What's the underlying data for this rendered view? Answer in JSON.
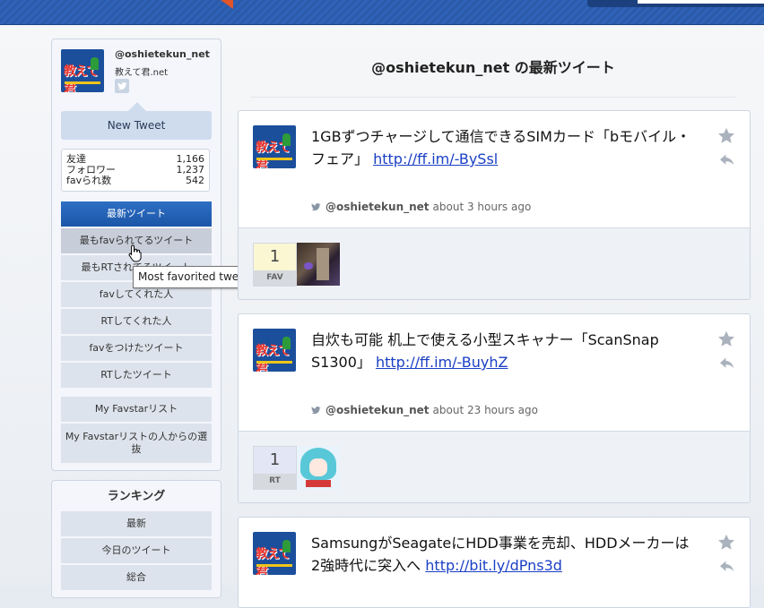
{
  "profile": {
    "username": "@oshietekun_net",
    "subtitle": "教えて君.net",
    "avatar_text": "教えて君",
    "new_tweet_label": "New Tweet",
    "stats": [
      {
        "label": "友達",
        "value": "1,166"
      },
      {
        "label": "フォロワー",
        "value": "1,237"
      },
      {
        "label": "favられ数",
        "value": "542"
      }
    ]
  },
  "menu": {
    "items": [
      {
        "label": "最新ツイート",
        "active": true
      },
      {
        "label": "最もfavられてるツイート"
      },
      {
        "label": "最もRTされてるツイート"
      },
      {
        "label": "favしてくれた人"
      },
      {
        "label": "RTしてくれた人"
      },
      {
        "label": "favをつけたツイート"
      },
      {
        "label": "RTしたツイート"
      }
    ],
    "list_items": [
      {
        "label": "My Favstarリスト"
      },
      {
        "label": "My Favstarリストの人からの選抜"
      }
    ],
    "tooltip": "Most favorited tweets"
  },
  "ranking": {
    "title": "ランキング",
    "items": [
      {
        "label": "最新"
      },
      {
        "label": "今日のツイート"
      },
      {
        "label": "総合"
      }
    ]
  },
  "main": {
    "title": "@oshietekun_net の最新ツイート"
  },
  "tweets": [
    {
      "text": "1GBずつチャージして通信できるSIMカード「bモバイル・フェア」",
      "link": "http://ff.im/-BySsl",
      "user": "@oshietekun_net",
      "time": "about 3 hours ago",
      "count": "1",
      "count_label": "FAV"
    },
    {
      "text": "自炊も可能 机上で使える小型スキャナー「ScanSnap S1300」",
      "link": "http://ff.im/-BuyhZ",
      "user": "@oshietekun_net",
      "time": "about 23 hours ago",
      "count": "1",
      "count_label": "RT"
    },
    {
      "text": "SamsungがSeagateにHDD事業を売却、HDDメーカーは2強時代に突入へ",
      "link": "http://bit.ly/dPns3d"
    }
  ],
  "icons": {
    "twitter": "twitter-bird-icon",
    "favorite": "star-icon",
    "reply": "reply-icon",
    "cursor": "hand-cursor-icon"
  },
  "colors": {
    "header": "#2f63b8",
    "active_menu": "#1e5fb4",
    "link": "#1a3fc4",
    "avatar_bg": "#1b4f9c"
  }
}
